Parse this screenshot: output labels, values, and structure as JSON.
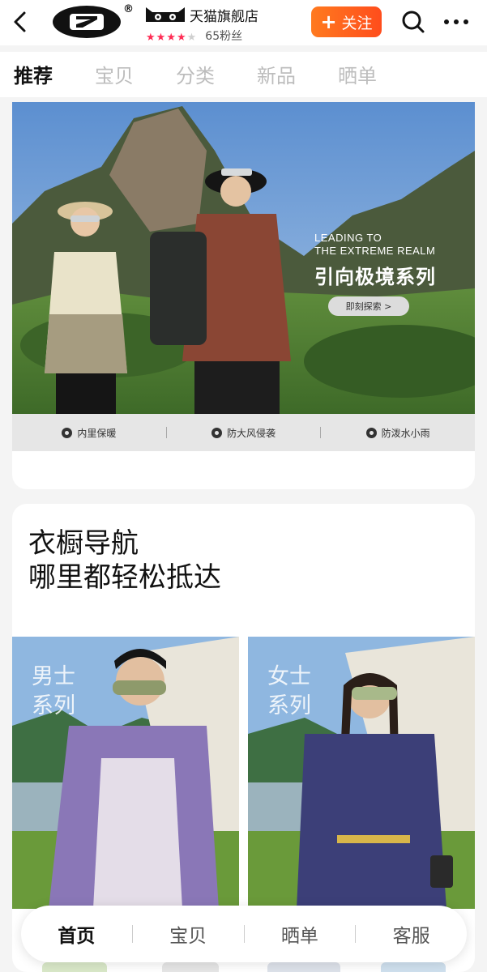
{
  "header": {
    "store_type": "天猫旗舰店",
    "registered_mark": "®",
    "rating_stars": 4,
    "rating_max": 5,
    "fans": "65粉丝",
    "follow_label": "关注",
    "follow_icon": "plus-icon",
    "accent_color": "#ff5a1f"
  },
  "tabs": [
    {
      "label": "推荐",
      "active": true
    },
    {
      "label": "宝贝",
      "active": false
    },
    {
      "label": "分类",
      "active": false
    },
    {
      "label": "新品",
      "active": false
    },
    {
      "label": "晒单",
      "active": false
    }
  ],
  "banner": {
    "en_line1": "LEADING TO",
    "en_line2": "THE EXTREME REALM",
    "cn_title": "引向极境系列",
    "cta_label": "即刻探索 >",
    "features": [
      "内里保暖",
      "防大风侵袭",
      "防泼水小雨"
    ]
  },
  "wardrobe": {
    "title_line1": "衣橱导航",
    "title_line2": "哪里都轻松抵达",
    "men": {
      "line1": "男士",
      "line2": "系列"
    },
    "women": {
      "line1": "女士",
      "line2": "系列"
    }
  },
  "bottom_nav": [
    {
      "label": "首页",
      "active": true
    },
    {
      "label": "宝贝",
      "active": false
    },
    {
      "label": "晒单",
      "active": false
    },
    {
      "label": "客服",
      "active": false
    }
  ]
}
